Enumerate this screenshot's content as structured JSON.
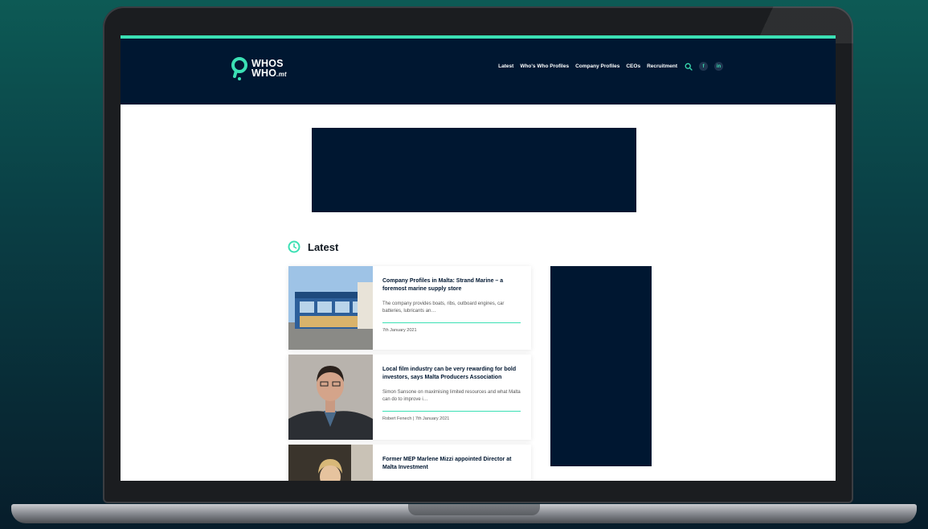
{
  "site": {
    "logo": {
      "line1": "WHOS",
      "line2": "WHO",
      "suffix": ".mt"
    },
    "nav": {
      "items": [
        {
          "label": "Latest"
        },
        {
          "label": "Who's Who Profiles"
        },
        {
          "label": "Company Profiles"
        },
        {
          "label": "CEOs"
        },
        {
          "label": "Recruitment"
        }
      ],
      "search_icon": "search-icon",
      "social": [
        {
          "icon": "facebook-icon",
          "glyph": "f"
        },
        {
          "icon": "linkedin-icon",
          "glyph": "in"
        }
      ]
    },
    "colors": {
      "navy": "#001731",
      "accent": "#3be0b4",
      "background": "#ffffff"
    }
  },
  "latest": {
    "heading": "Latest",
    "icon": "clock-icon",
    "articles": [
      {
        "title": "Company Profiles in Malta: Strand Marine – a foremost marine supply store",
        "excerpt": "The company provides boats, ribs, outboard engines, car batteries, lubricants an…",
        "meta": "7th January 2021"
      },
      {
        "title": "Local film industry can be very rewarding for bold investors, says Malta Producers Association",
        "excerpt": "Simon Sansone on maximising limited resources and what Malta can do to improve i…",
        "meta": "Robert Fenech | 7th January 2021"
      },
      {
        "title": "Former MEP Marlene Mizzi appointed Director at Malta Investment"
      }
    ]
  }
}
